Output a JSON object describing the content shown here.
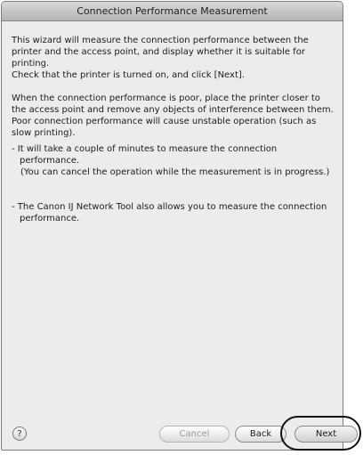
{
  "window": {
    "title": "Connection Performance Measurement"
  },
  "content": {
    "para1": [
      "This wizard will measure the connection performance between the printer and the access point, and display whether it is suitable for printing.",
      "Check that the printer is turned on, and click [Next]."
    ],
    "para2": [
      "When the connection performance is poor, place the printer closer to the access point and remove any objects of interference between them.",
      "Poor connection performance will cause unstable operation (such as slow printing)."
    ],
    "bullet1": {
      "text": "- It will take a couple of minutes to measure the connection performance.",
      "sub": "(You can cancel the operation while the measurement is in progress.)"
    },
    "bullet2": {
      "text": "- The Canon IJ Network Tool also allows you to measure the connection performance."
    }
  },
  "buttons": {
    "help": "?",
    "cancel": "Cancel",
    "back": "Back",
    "next": "Next"
  }
}
